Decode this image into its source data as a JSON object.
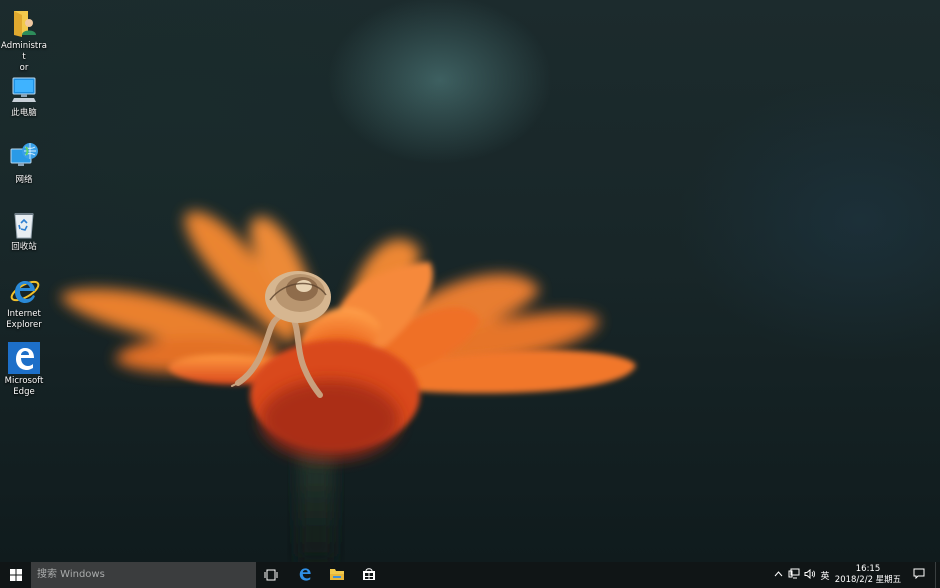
{
  "desktop": {
    "icons": [
      {
        "label": "Administrat\nor",
        "icon": "user-folder-icon"
      },
      {
        "label": "此电脑",
        "icon": "this-pc-icon"
      },
      {
        "label": "网络",
        "icon": "network-icon"
      },
      {
        "label": "回收站",
        "icon": "recycle-bin-icon"
      },
      {
        "label": "Internet\nExplorer",
        "icon": "internet-explorer-icon"
      },
      {
        "label": "Microsoft\nEdge",
        "icon": "edge-icon"
      }
    ]
  },
  "taskbar": {
    "search_placeholder": "搜索 Windows",
    "pinned": [
      "task-view-icon",
      "edge-icon",
      "file-explorer-icon",
      "store-icon"
    ],
    "tray": {
      "ime": "英",
      "time": "16:15",
      "date": "2018/2/2 星期五"
    }
  },
  "colors": {
    "taskbar": "#101516",
    "search": "#3b3d3e",
    "accent": "#1e78d7",
    "petal": "#f07a28"
  }
}
